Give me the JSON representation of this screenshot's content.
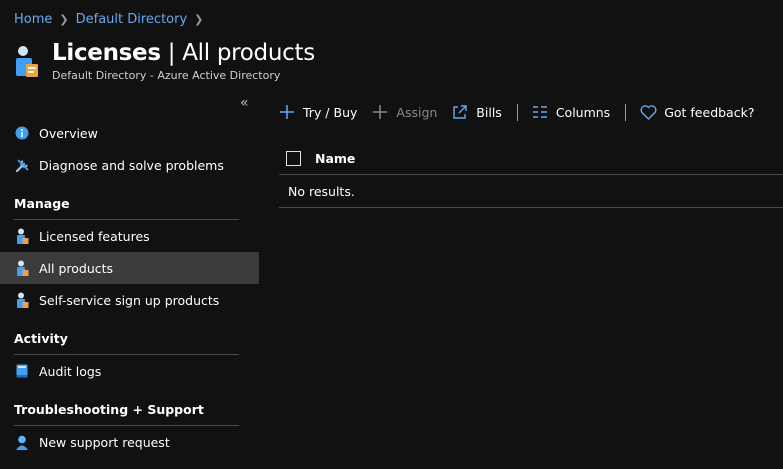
{
  "breadcrumb": {
    "home": "Home",
    "directory": "Default Directory"
  },
  "header": {
    "title_main": "Licenses",
    "title_rest": " | All products",
    "subtitle": "Default Directory - Azure Active Directory"
  },
  "sidebar": {
    "collapse_glyph": "«",
    "items_top": [
      {
        "label": "Overview",
        "icon": "info-icon"
      },
      {
        "label": "Diagnose and solve problems",
        "icon": "wrench-icon"
      }
    ],
    "manage": {
      "title": "Manage",
      "items": [
        {
          "label": "Licensed features",
          "icon": "license-icon"
        },
        {
          "label": "All products",
          "icon": "license-icon",
          "active": true
        },
        {
          "label": "Self-service sign up products",
          "icon": "license-icon"
        }
      ]
    },
    "activity": {
      "title": "Activity",
      "items": [
        {
          "label": "Audit logs",
          "icon": "book-icon"
        }
      ]
    },
    "support": {
      "title": "Troubleshooting + Support",
      "items": [
        {
          "label": "New support request",
          "icon": "support-person-icon"
        }
      ]
    }
  },
  "toolbar": {
    "try_buy": "Try / Buy",
    "assign": "Assign",
    "bills": "Bills",
    "columns": "Columns",
    "feedback": "Got feedback?"
  },
  "grid": {
    "column_name": "Name",
    "empty_text": "No results."
  },
  "colors": {
    "background": "#111111",
    "link": "#69a7ef",
    "accent": "#3f9ff0",
    "active_row": "#3b3b3b"
  }
}
